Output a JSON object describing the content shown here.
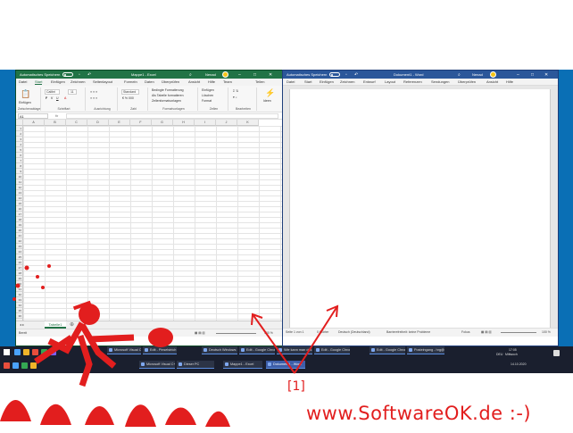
{
  "excel": {
    "title_autosave": "Automatisches Speichern",
    "title_doc": "Mappe1 - Excel",
    "user": "Nenad",
    "tabs": [
      "Datei",
      "Start",
      "Einfügen",
      "Zeichnen",
      "Seitenlayout",
      "Formeln",
      "Daten",
      "Überprüfen",
      "Ansicht",
      "Hilfe",
      "Team"
    ],
    "share": "Teilen",
    "ribbon": {
      "paste": "Einfügen",
      "clipboard": "Zwischenablage",
      "font_name": "Calibri",
      "font_size": "11",
      "font_group": "Schriftart",
      "alignment_group": "Ausrichtung",
      "number_format": "Standard",
      "number_group": "Zahl",
      "cond_format": "Bedingte Formatierung",
      "as_table": "Als Tabelle formatieren",
      "cell_styles": "Zellenformatvorlagen",
      "styles_group": "Formatvorlagen",
      "insert": "Einfügen",
      "delete": "Löschen",
      "format": "Format",
      "cells_group": "Zellen",
      "edit_group": "Bearbeiten",
      "ideas": "Ideen"
    },
    "namebox": "A1",
    "fx": "fx",
    "columns": [
      "A",
      "B",
      "C",
      "D",
      "E",
      "F",
      "G",
      "H",
      "I",
      "J",
      "K"
    ],
    "rows": [
      "1",
      "2",
      "3",
      "4",
      "5",
      "6",
      "7",
      "8",
      "9",
      "10",
      "11",
      "12",
      "13",
      "14",
      "15",
      "16",
      "17",
      "18",
      "19",
      "20",
      "21",
      "22",
      "23",
      "24",
      "25",
      "26",
      "27",
      "28",
      "29",
      "30",
      "31",
      "32",
      "33",
      "34",
      "35",
      "36",
      "37"
    ],
    "sheet_tab": "Tabelle1",
    "status_ready": "Bereit",
    "zoom": "100 %"
  },
  "word": {
    "title_autosave": "Automatisches Speichern",
    "title_doc": "Dokument1 - Word",
    "user": "Nenad",
    "tabs": [
      "Datei",
      "Start",
      "Einfügen",
      "Zeichnen",
      "Entwurf",
      "Layout",
      "Referenzen",
      "Sendungen",
      "Überprüfen",
      "Ansicht",
      "Hilfe"
    ],
    "status_page": "Seite 1 von 1",
    "status_words": "0 Wörter",
    "status_lang": "Deutsch (Deutschland)",
    "status_access": "Barrierefreiheit: keine Probleme",
    "status_focus": "Fokus",
    "zoom": "100 %"
  },
  "taskbar": {
    "row1": [
      "Microsoft Visual C++ ...",
      "Edit - Pinselstrich - Mi...",
      "Deutsch Windows 10...",
      "Edit - Google Chrome",
      "Wie kann man das ...",
      "Edit - Google Chrome",
      "Edit - Google Chrome",
      "Posteingang - hrg@n..."
    ],
    "row2": [
      "Microsoft Visual C++ ...",
      "Dieser PC",
      "Mappe1 - Excel",
      "Dokument1 - Word"
    ],
    "time": "17:05",
    "date": "14.10.2020",
    "lang": "DEU",
    "day": "Mittwoch"
  },
  "annotation": {
    "label": "[1]"
  },
  "brand": "www.SoftwareOK.de :-)",
  "colors": {
    "excel_green": "#217346",
    "word_blue": "#2b579a",
    "desktop_blue": "#0a6fb5",
    "taskbar": "#1a1f2e",
    "annotation_red": "#e21e1e"
  }
}
